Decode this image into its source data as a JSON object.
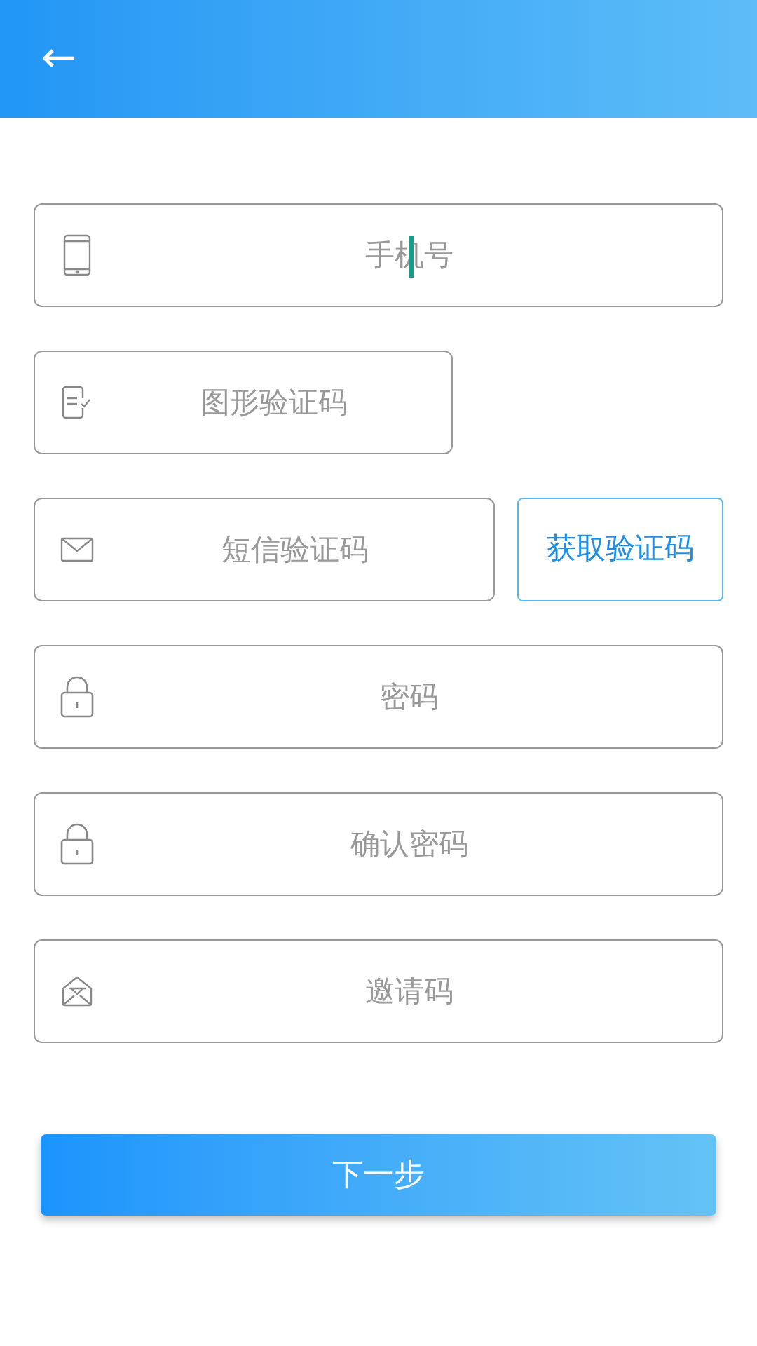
{
  "header": {
    "back": "←"
  },
  "fields": [
    {
      "kind": "phone",
      "placeholder": "手机号",
      "focused": true
    },
    {
      "kind": "captcha",
      "placeholder": "图形验证码",
      "focused": false
    },
    {
      "kind": "sms",
      "placeholder": "短信验证码",
      "focused": false,
      "action": "获取验证码"
    },
    {
      "kind": "password",
      "placeholder": "密码",
      "focused": false
    },
    {
      "kind": "password",
      "placeholder": "确认密码",
      "focused": false
    },
    {
      "kind": "invite",
      "placeholder": "邀请码",
      "focused": false
    }
  ],
  "submit": "下一步"
}
